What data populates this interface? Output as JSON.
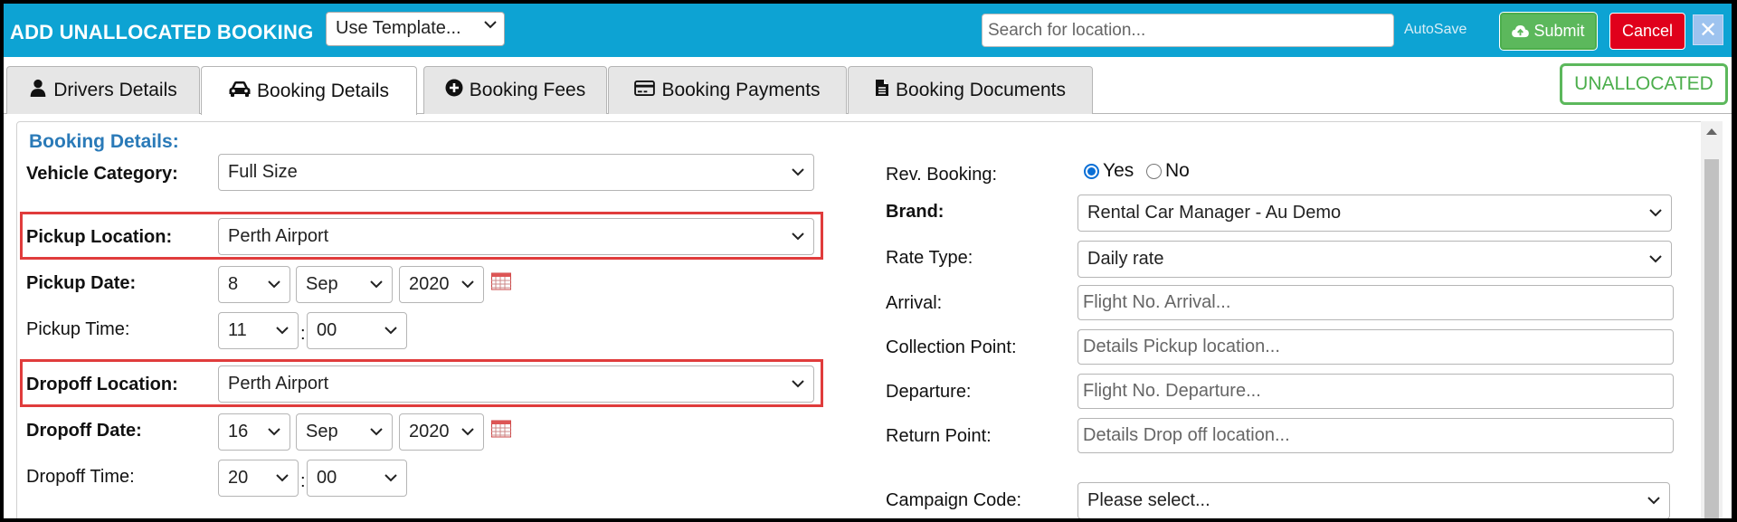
{
  "header": {
    "title": "ADD UNALLOCATED BOOKING",
    "template_select": "Use Template...",
    "search_placeholder": "Search for location...",
    "autosave_label": "AutoSave",
    "submit_label": "Submit",
    "cancel_label": "Cancel",
    "close_symbol": "✕"
  },
  "tabs": [
    {
      "label": "Drivers Details",
      "icon": "user-icon"
    },
    {
      "label": "Booking Details",
      "icon": "car-icon",
      "active": true
    },
    {
      "label": "Booking Fees",
      "icon": "plus-circle-icon"
    },
    {
      "label": "Booking Payments",
      "icon": "credit-card-icon"
    },
    {
      "label": "Booking Documents",
      "icon": "document-icon"
    }
  ],
  "status_badge": "UNALLOCATED",
  "section_title": "Booking Details:",
  "left": {
    "vehicle_category": {
      "label": "Vehicle Category:",
      "value": "Full Size"
    },
    "pickup_location": {
      "label": "Pickup Location:",
      "value": "Perth Airport"
    },
    "pickup_date": {
      "label": "Pickup Date:",
      "day": "8",
      "month": "Sep",
      "year": "2020"
    },
    "pickup_time": {
      "label": "Pickup Time:",
      "hour": "11",
      "minute": "00"
    },
    "dropoff_location": {
      "label": "Dropoff Location:",
      "value": "Perth Airport"
    },
    "dropoff_date": {
      "label": "Dropoff Date:",
      "day": "16",
      "month": "Sep",
      "year": "2020"
    },
    "dropoff_time": {
      "label": "Dropoff Time:",
      "hour": "20",
      "minute": "00"
    },
    "time_separator": ":"
  },
  "right": {
    "rev_booking": {
      "label": "Rev. Booking:",
      "yes": "Yes",
      "no": "No",
      "selected": "Yes"
    },
    "brand": {
      "label": "Brand:",
      "value": "Rental Car Manager - Au Demo"
    },
    "rate_type": {
      "label": "Rate Type:",
      "value": "Daily rate"
    },
    "arrival": {
      "label": "Arrival:",
      "placeholder": "Flight No. Arrival..."
    },
    "collection_point": {
      "label": "Collection Point:",
      "placeholder": "Details Pickup location..."
    },
    "departure": {
      "label": "Departure:",
      "placeholder": "Flight No. Departure..."
    },
    "return_point": {
      "label": "Return Point:",
      "placeholder": "Details Drop off location..."
    },
    "campaign_code": {
      "label": "Campaign Code:",
      "value": "Please select..."
    }
  },
  "colors": {
    "header_bg": "#0da3d3",
    "submit_green": "#5cb85c",
    "cancel_red": "#e0001b",
    "section_blue": "#2a7ab8",
    "highlight_red": "#e03c3c"
  }
}
